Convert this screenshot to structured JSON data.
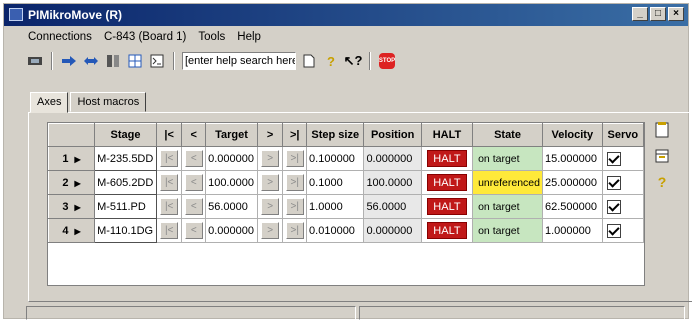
{
  "window": {
    "title": "PIMikroMove (R)"
  },
  "menu": [
    "Connections",
    "C-843 (Board 1)",
    "Tools",
    "Help"
  ],
  "toolbar": {
    "help_search_value": "[enter help search here]"
  },
  "tabs": [
    {
      "label": "Axes",
      "active": true
    },
    {
      "label": "Host macros",
      "active": false
    }
  ],
  "grid": {
    "headers": [
      "Stage",
      "|<",
      "<",
      "Target",
      ">",
      ">|",
      "Step size",
      "Position",
      "HALT",
      "State",
      "Velocity",
      "Servo"
    ],
    "rows": [
      {
        "num": "1",
        "stage": "M-235.5DD",
        "target": "0.000000",
        "step": "0.100000",
        "position": "0.000000",
        "halt": "HALT",
        "state": "on target",
        "state_kind": "ok",
        "velocity": "15.000000",
        "servo": true
      },
      {
        "num": "2",
        "stage": "M-605.2DD",
        "target": "100.0000",
        "step": "0.1000",
        "position": "100.0000",
        "halt": "HALT",
        "state": "unreferenced",
        "state_kind": "warn",
        "velocity": "25.000000",
        "servo": true
      },
      {
        "num": "3",
        "stage": "M-511.PD",
        "target": "56.0000",
        "step": "1.0000",
        "position": "56.0000",
        "halt": "HALT",
        "state": "on target",
        "state_kind": "ok",
        "velocity": "62.500000",
        "servo": true
      },
      {
        "num": "4",
        "stage": "M-110.1DG",
        "target": "0.000000",
        "step": "0.010000",
        "position": "0.000000",
        "halt": "HALT",
        "state": "on target",
        "state_kind": "ok",
        "velocity": "1.000000",
        "servo": true
      }
    ],
    "nav_buttons": {
      "first": "|<",
      "prev": "<",
      "next": ">",
      "last": ">|"
    }
  },
  "colors": {
    "titlebar_start": "#0a246a",
    "titlebar_end": "#3a6ea5",
    "halt": "#c01818",
    "state_ok": "#c7e6c0",
    "state_warn": "#ffe93a"
  }
}
